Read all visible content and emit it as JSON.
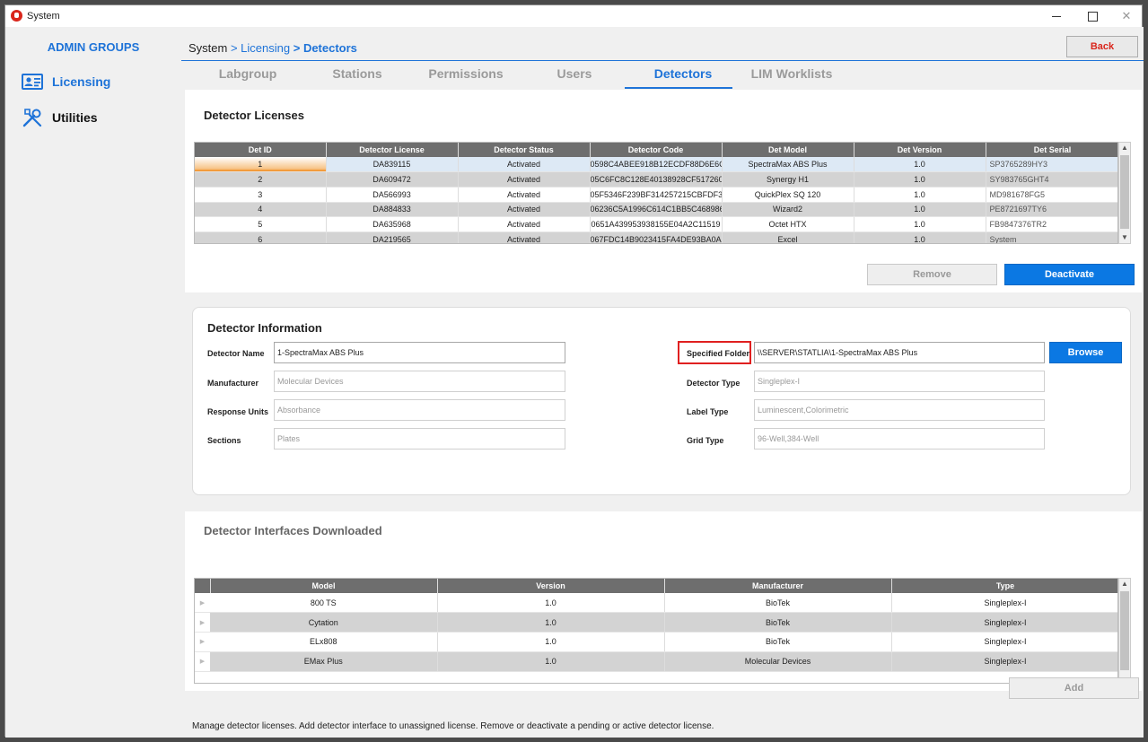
{
  "window": {
    "title": "System",
    "minimize": "",
    "maximize": "",
    "close": "✕"
  },
  "sidebar": {
    "title": "ADMIN GROUPS",
    "items": [
      {
        "label": "Licensing",
        "icon": "id-card-icon"
      },
      {
        "label": "Utilities",
        "icon": "tools-icon"
      }
    ]
  },
  "breadcrumb": {
    "root": "System",
    "sep1": " > ",
    "mid": "Licensing",
    "sep2": " > ",
    "current": "Detectors"
  },
  "back_label": "Back",
  "tabs": [
    {
      "label": "Labgroup"
    },
    {
      "label": "Stations"
    },
    {
      "label": "Permissions"
    },
    {
      "label": "Users"
    },
    {
      "label": "Detectors"
    },
    {
      "label": "LIM Worklists"
    }
  ],
  "licenses": {
    "title": "Detector Licenses",
    "columns": [
      "Det ID",
      "Detector License",
      "Detector Status",
      "Detector Code",
      "Det Model",
      "Det Version",
      "Det Serial"
    ],
    "rows": [
      [
        "1",
        "DA839115",
        "Activated",
        "0598C4ABEE918B12ECDF88D6E6CD",
        "SpectraMax ABS Plus",
        "1.0",
        "SP3765289HY3"
      ],
      [
        "2",
        "DA609472",
        "Activated",
        "05C6FC8C128E40138928CF517260",
        "Synergy H1",
        "1.0",
        "SY983765GHT4"
      ],
      [
        "3",
        "DA566993",
        "Activated",
        "05F5346F239BF314257215CBFDF3",
        "QuickPlex SQ 120",
        "1.0",
        "MD981678FG5"
      ],
      [
        "4",
        "DA884833",
        "Activated",
        "06236C5A1996C614C1BB5C468986",
        "Wizard2",
        "1.0",
        "PE8721697TY6"
      ],
      [
        "5",
        "DA635968",
        "Activated",
        "0651A439953938155E04A2C11519",
        "Octet HTX",
        "1.0",
        "FB9847376TR2"
      ],
      [
        "6",
        "DA219565",
        "Activated",
        "067FDC14B9023415FA4DE93BA0AC",
        "Excel",
        "1.0",
        "System"
      ]
    ],
    "remove_label": "Remove",
    "deactivate_label": "Deactivate"
  },
  "info": {
    "title": "Detector Information",
    "detector_name_label": "Detector Name",
    "detector_name_value": "1-SpectraMax ABS Plus",
    "manufacturer_label": "Manufacturer",
    "manufacturer_value": "Molecular Devices",
    "response_units_label": "Response Units",
    "response_units_value": "Absorbance",
    "sections_label": "Sections",
    "sections_value": "Plates",
    "specified_folder_label": "Specified Folder",
    "specified_folder_value": "\\\\SERVER\\STATLIA\\1-SpectraMax ABS Plus",
    "browse_label": "Browse",
    "detector_type_label": "Detector Type",
    "detector_type_value": "Singleplex-I",
    "label_type_label": "Label Type",
    "label_type_value": "Luminescent,Colorimetric",
    "grid_type_label": "Grid Type",
    "grid_type_value": "96-Well,384-Well"
  },
  "interfaces": {
    "title": "Detector Interfaces Downloaded",
    "columns": [
      "Model",
      "Version",
      "Manufacturer",
      "Type"
    ],
    "rows": [
      [
        "800 TS",
        "1.0",
        "BioTek",
        "Singleplex-I"
      ],
      [
        "Cytation",
        "1.0",
        "BioTek",
        "Singleplex-I"
      ],
      [
        "ELx808",
        "1.0",
        "BioTek",
        "Singleplex-I"
      ],
      [
        "EMax Plus",
        "1.0",
        "Molecular Devices",
        "Singleplex-I"
      ]
    ],
    "add_label": "Add"
  },
  "footer": "Manage detector licenses.  Add detector interface to unassigned license.  Remove or deactivate a pending or active detector license.",
  "colors": {
    "accent": "#1e73d8",
    "primary_button": "#0b78e3",
    "back_text": "#d9261c",
    "highlight_border": "#e02020"
  }
}
